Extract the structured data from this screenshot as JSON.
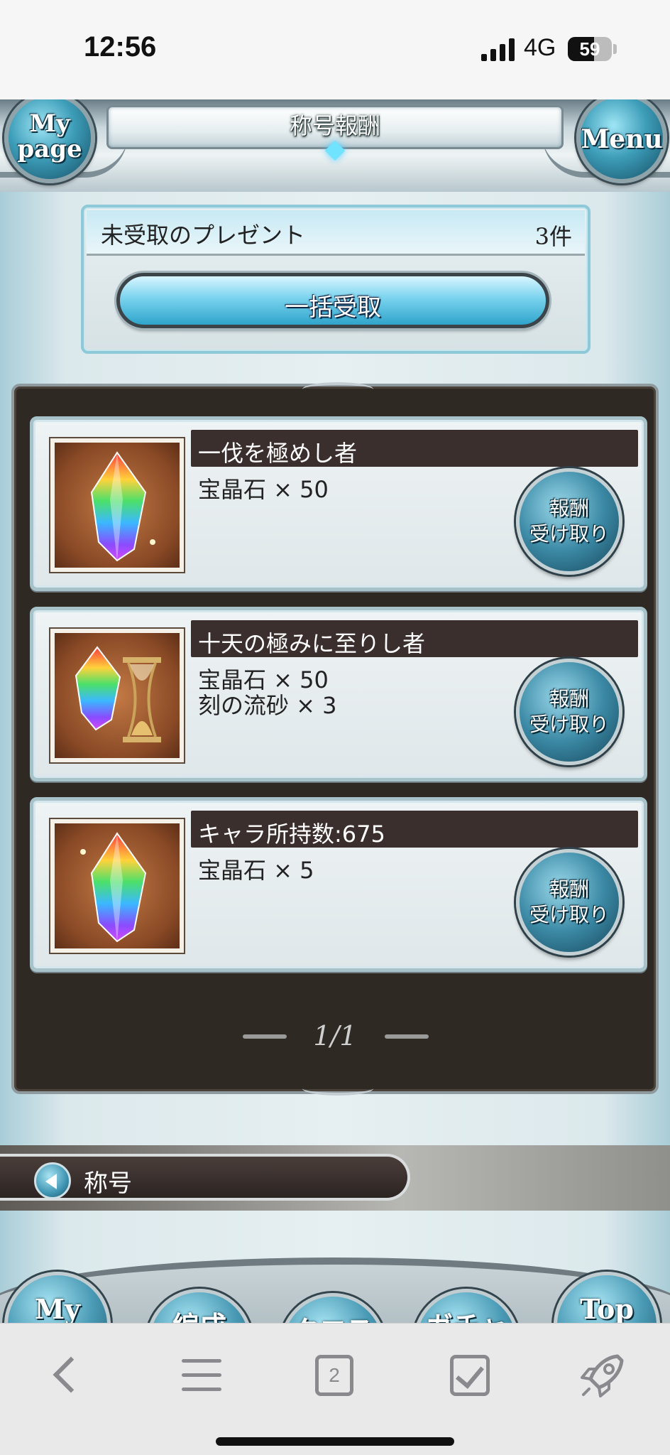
{
  "status_bar": {
    "time": "12:56",
    "network": "4G",
    "battery": "59",
    "battery_percent": 59
  },
  "header": {
    "title": "称号報酬",
    "mypage_button": "My page",
    "menu_button": "Menu"
  },
  "present": {
    "label": "未受取のプレゼント",
    "count": "3件",
    "collect_all_label": "一括受取"
  },
  "rewards": [
    {
      "name": "一伐を極めし者",
      "items": [
        "宝晶石 × 50"
      ],
      "thumb_icon": "rainbow-crystal-icon",
      "claim_label_line1": "報酬",
      "claim_label_line2": "受け取り"
    },
    {
      "name": "十天の極みに至りし者",
      "items": [
        "宝晶石 × 50",
        "刻の流砂 × 3"
      ],
      "thumb_icon": "crystal-and-hourglass-icon",
      "claim_label_line1": "報酬",
      "claim_label_line2": "受け取り"
    },
    {
      "name": "キャラ所持数:675",
      "items": [
        "宝晶石 × 5"
      ],
      "thumb_icon": "rainbow-crystal-icon",
      "claim_label_line1": "報酬",
      "claim_label_line2": "受け取り"
    }
  ],
  "pager": {
    "text": "1/1"
  },
  "title_bar": {
    "label": "称号"
  },
  "game_nav": {
    "items": [
      "My page",
      "編成",
      "クエスト",
      "ガチャ",
      "Top"
    ]
  },
  "browser_toolbar": {
    "tab_count": "2"
  },
  "colors": {
    "accent_blue": "#3c9ec0",
    "panel_dark": "#2f2923",
    "name_bar": "#3a2f2c"
  }
}
